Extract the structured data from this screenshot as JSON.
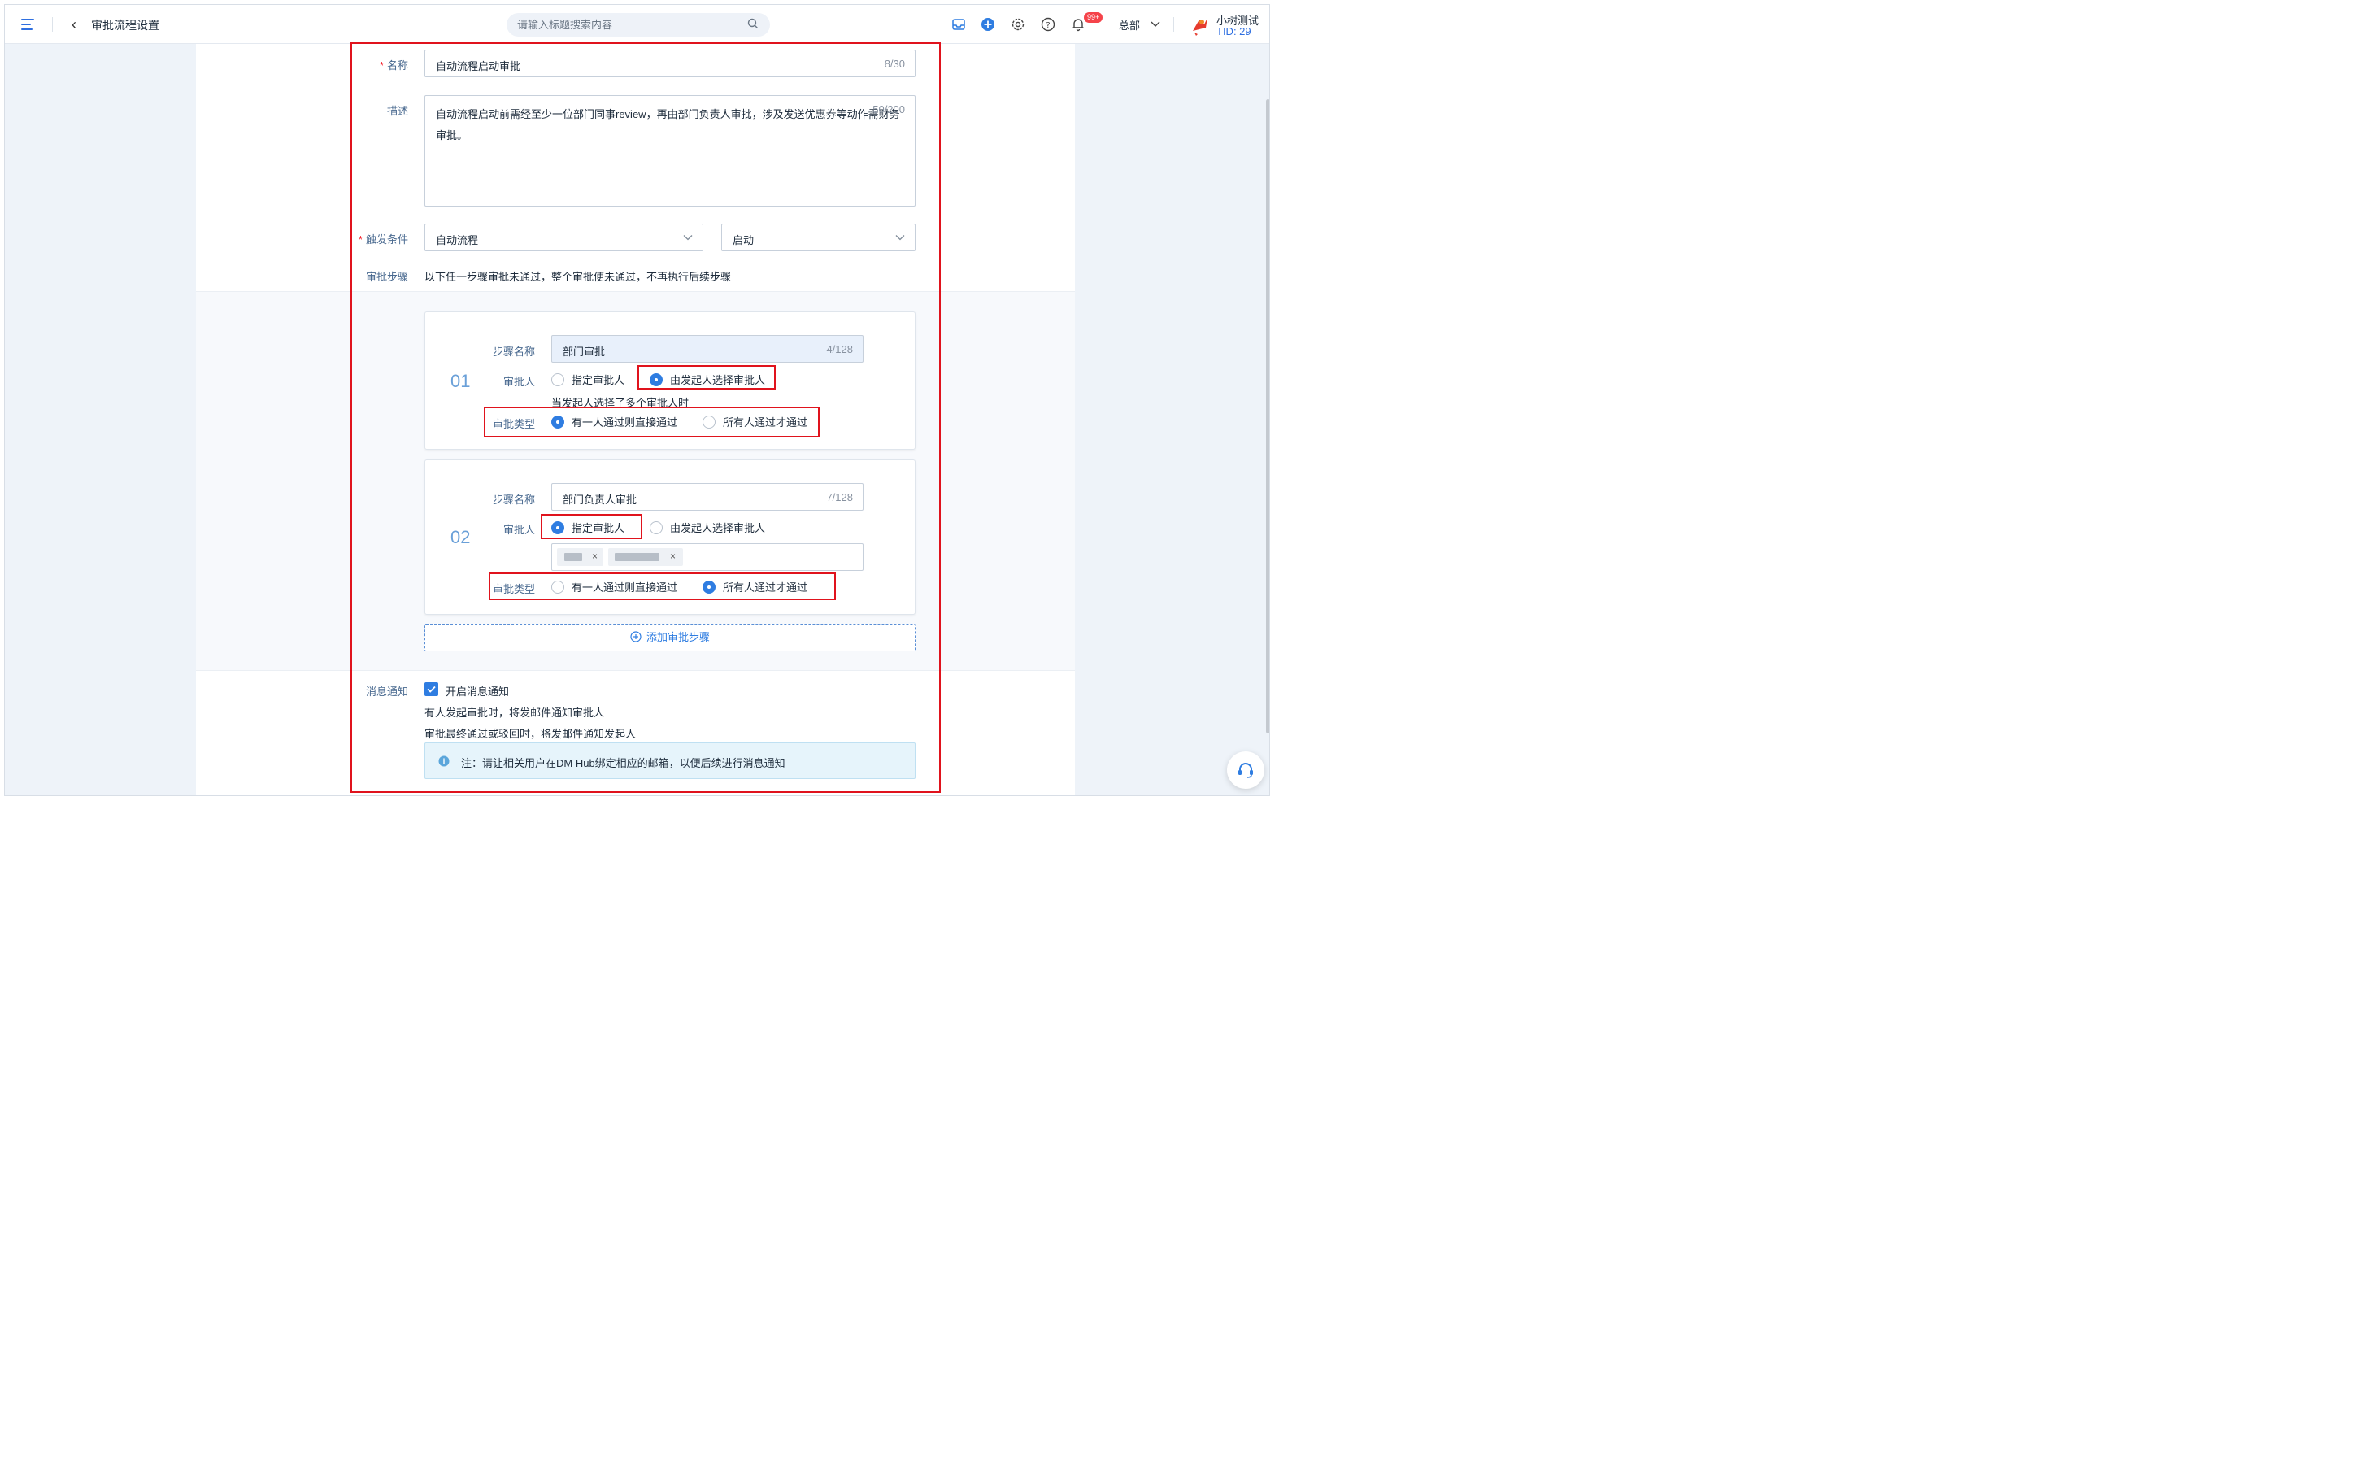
{
  "header": {
    "title": "审批流程设置",
    "search_placeholder": "请输入标题搜索内容",
    "notification_badge": "99+",
    "org": "总部",
    "user_name": "小树测试",
    "user_tid": "TID: 29"
  },
  "form": {
    "name": {
      "label": "名称",
      "required": true,
      "value": "自动流程启动审批",
      "counter": "8/30"
    },
    "description": {
      "label": "描述",
      "value": "自动流程启动前需经至少一位部门同事review，再由部门负责人审批，涉及发送优惠券等动作需财务审批。",
      "counter": "50/200"
    },
    "trigger": {
      "label": "触发条件",
      "required": true,
      "type_value": "自动流程",
      "event_value": "启动"
    },
    "steps_section": {
      "label": "审批步骤",
      "note": "以下任一步骤审批未通过，整个审批便未通过，不再执行后续步骤"
    },
    "steps": [
      {
        "number": "01",
        "name_label": "步骤名称",
        "name_value": "部门审批",
        "name_counter": "4/128",
        "approver_label": "审批人",
        "approver_options": [
          "指定审批人",
          "由发起人选择审批人"
        ],
        "approver_selected": 1,
        "multi_hint": "当发起人选择了多个审批人时",
        "type_label": "审批类型",
        "type_options": [
          "有一人通过则直接通过",
          "所有人通过才通过"
        ],
        "type_selected": 0
      },
      {
        "number": "02",
        "name_label": "步骤名称",
        "name_value": "部门负责人审批",
        "name_counter": "7/128",
        "approver_label": "审批人",
        "approver_options": [
          "指定审批人",
          "由发起人选择审批人"
        ],
        "approver_selected": 0,
        "approver_tags": [
          "×",
          "×"
        ],
        "type_label": "审批类型",
        "type_options": [
          "有一人通过则直接通过",
          "所有人通过才通过"
        ],
        "type_selected": 1
      }
    ],
    "add_step_label": "添加审批步骤",
    "notification": {
      "label": "消息通知",
      "checkbox_label": "开启消息通知",
      "checked": true,
      "line1": "有人发起审批时，将发邮件通知审批人",
      "line2": "审批最终通过或驳回时，将发邮件通知发起人",
      "note": "注：请让相关用户在DM Hub绑定相应的邮箱，以便后续进行消息通知"
    }
  },
  "colors": {
    "accent": "#2f7de1",
    "highlight_box": "#e0131d",
    "label": "#4a6a90"
  }
}
